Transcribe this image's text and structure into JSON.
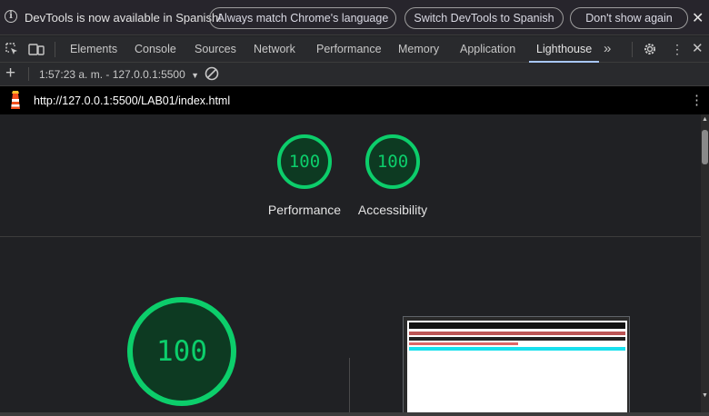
{
  "infobar": {
    "message": "DevTools is now available in Spanish!",
    "buttons": [
      "Always match Chrome's language",
      "Switch DevTools to Spanish",
      "Don't show again"
    ]
  },
  "tabs": [
    {
      "label": "Elements"
    },
    {
      "label": "Console"
    },
    {
      "label": "Sources"
    },
    {
      "label": "Network"
    },
    {
      "label": "Performance"
    },
    {
      "label": "Memory"
    },
    {
      "label": "Application"
    },
    {
      "label": "Lighthouse",
      "active": true
    }
  ],
  "toolbar": {
    "report_select": "1:57:23 a. m. - 127.0.0.1:5500"
  },
  "report": {
    "url": "http://127.0.0.1:5500/LAB01/index.html",
    "summary": [
      {
        "label": "Performance",
        "score": "100"
      },
      {
        "label": "Accessibility",
        "score": "100"
      }
    ],
    "main_score": "100",
    "accent_color": "#0cce6b"
  }
}
